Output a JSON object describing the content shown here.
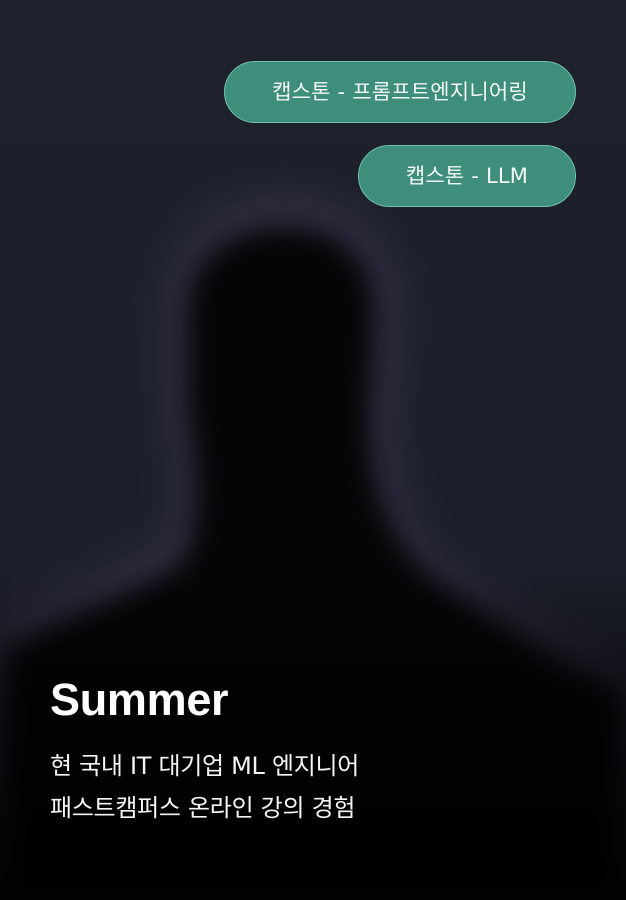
{
  "tags": [
    {
      "label": "캡스톤 - 프롬프트엔지니어링"
    },
    {
      "label": "캡스톤 -  LLM"
    }
  ],
  "profile": {
    "name": "Summer",
    "description_lines": [
      "현 국내 IT 대기업 ML 엔지니어",
      "패스트캠퍼스 온라인 강의 경험"
    ]
  },
  "colors": {
    "background": "#1c1f29",
    "tag_fill": "#3f8e7c",
    "tag_border": "#6fc1ae",
    "text": "#ffffff"
  }
}
